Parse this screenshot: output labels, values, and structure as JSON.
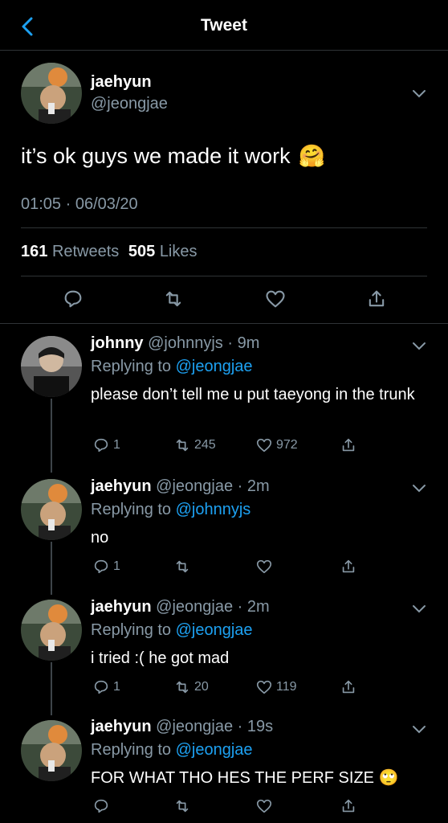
{
  "header": {
    "title": "Tweet"
  },
  "main_tweet": {
    "name": "jaehyun",
    "handle": "@jeongjae",
    "text": "it’s ok guys we made it work",
    "emoji": "🤗",
    "timestamp": "01:05 · 06/03/20",
    "retweets_count": "161",
    "retweets_label": "Retweets",
    "likes_count": "505",
    "likes_label": "Likes"
  },
  "replies": [
    {
      "name": "johnny",
      "meta": "@johnnyjs · 9m",
      "replying_prefix": "Replying to",
      "replying_to": "@jeongjae",
      "text": "please don’t tell me u put taeyong in the trunk",
      "reply_count": "1",
      "retweet_count": "245",
      "like_count": "972"
    },
    {
      "name": "jaehyun",
      "meta": "@jeongjae · 2m",
      "replying_prefix": "Replying to",
      "replying_to": "@johnnyjs",
      "text": "no",
      "reply_count": "1",
      "retweet_count": "",
      "like_count": ""
    },
    {
      "name": "jaehyun",
      "meta": "@jeongjae · 2m",
      "replying_prefix": "Replying to",
      "replying_to": "@jeongjae",
      "text": "i tried :( he got mad",
      "reply_count": "1",
      "retweet_count": "20",
      "like_count": "119"
    },
    {
      "name": "jaehyun",
      "meta": "@jeongjae · 19s",
      "replying_prefix": "Replying to",
      "replying_to": "@jeongjae",
      "text": "FOR WHAT THO HES THE PERF SIZE",
      "emoji": "🙄",
      "reply_count": "",
      "retweet_count": "",
      "like_count": ""
    }
  ],
  "colors": {
    "background": "#000000",
    "accent": "#1da1f2",
    "muted": "#8899a6",
    "divider": "#2f3336"
  },
  "icons": [
    "back-chevron-icon",
    "reply-icon",
    "retweet-icon",
    "like-icon",
    "share-icon",
    "more-chevron-icon"
  ]
}
